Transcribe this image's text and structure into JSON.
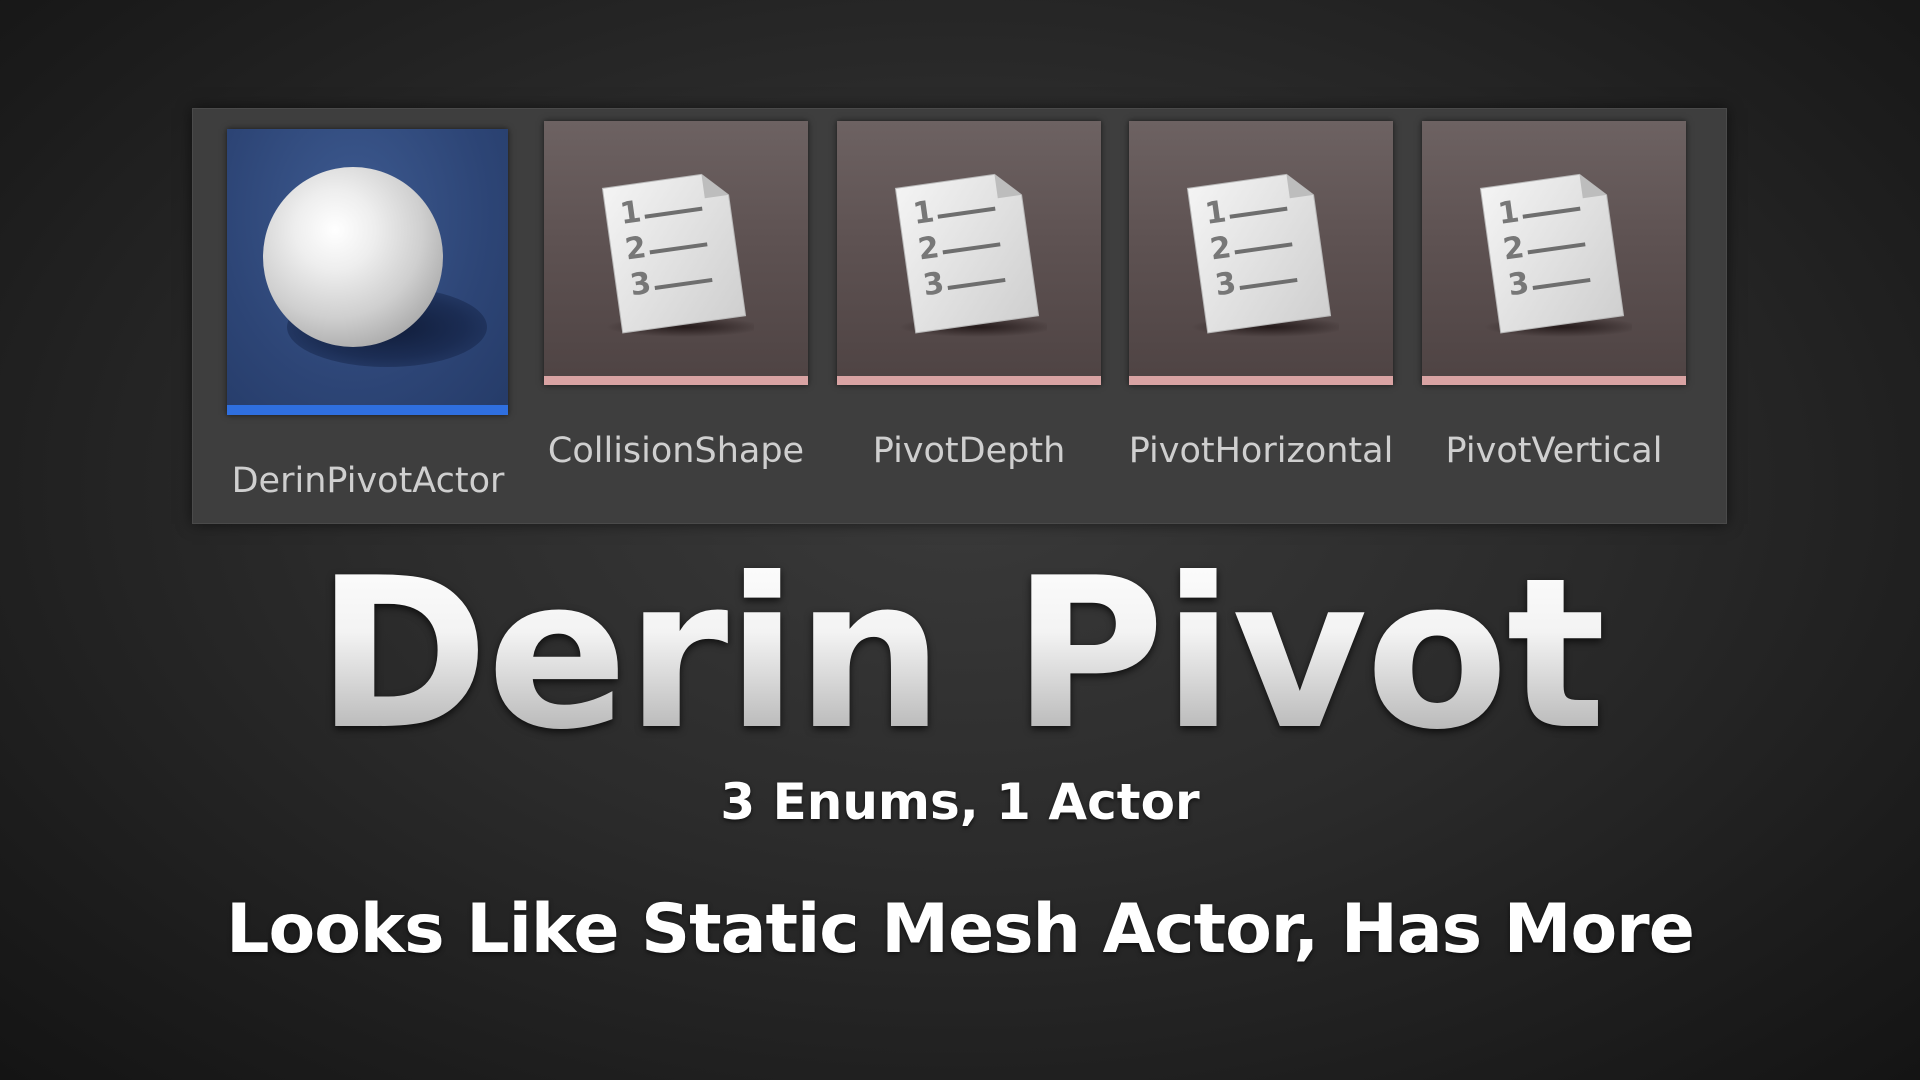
{
  "assets": [
    {
      "label": "DerinPivotActor",
      "type": "actor",
      "icon": "sphere-icon",
      "stripe_color": "#2f6fdf"
    },
    {
      "label": "CollisionShape",
      "type": "enum",
      "icon": "numbered-list-icon",
      "stripe_color": "#d9a3a3"
    },
    {
      "label": "PivotDepth",
      "type": "enum",
      "icon": "numbered-list-icon",
      "stripe_color": "#d9a3a3"
    },
    {
      "label": "PivotHorizontal",
      "type": "enum",
      "icon": "numbered-list-icon",
      "stripe_color": "#d9a3a3"
    },
    {
      "label": "PivotVertical",
      "type": "enum",
      "icon": "numbered-list-icon",
      "stripe_color": "#d9a3a3"
    }
  ],
  "title": "Derin Pivot",
  "subtitle": "3 Enums, 1 Actor",
  "tagline": "Looks Like Static Mesh Actor, Has More",
  "colors": {
    "actor_tile": "#2d4576",
    "enum_tile": "#5e5252",
    "panel": "#3e3e3e"
  }
}
